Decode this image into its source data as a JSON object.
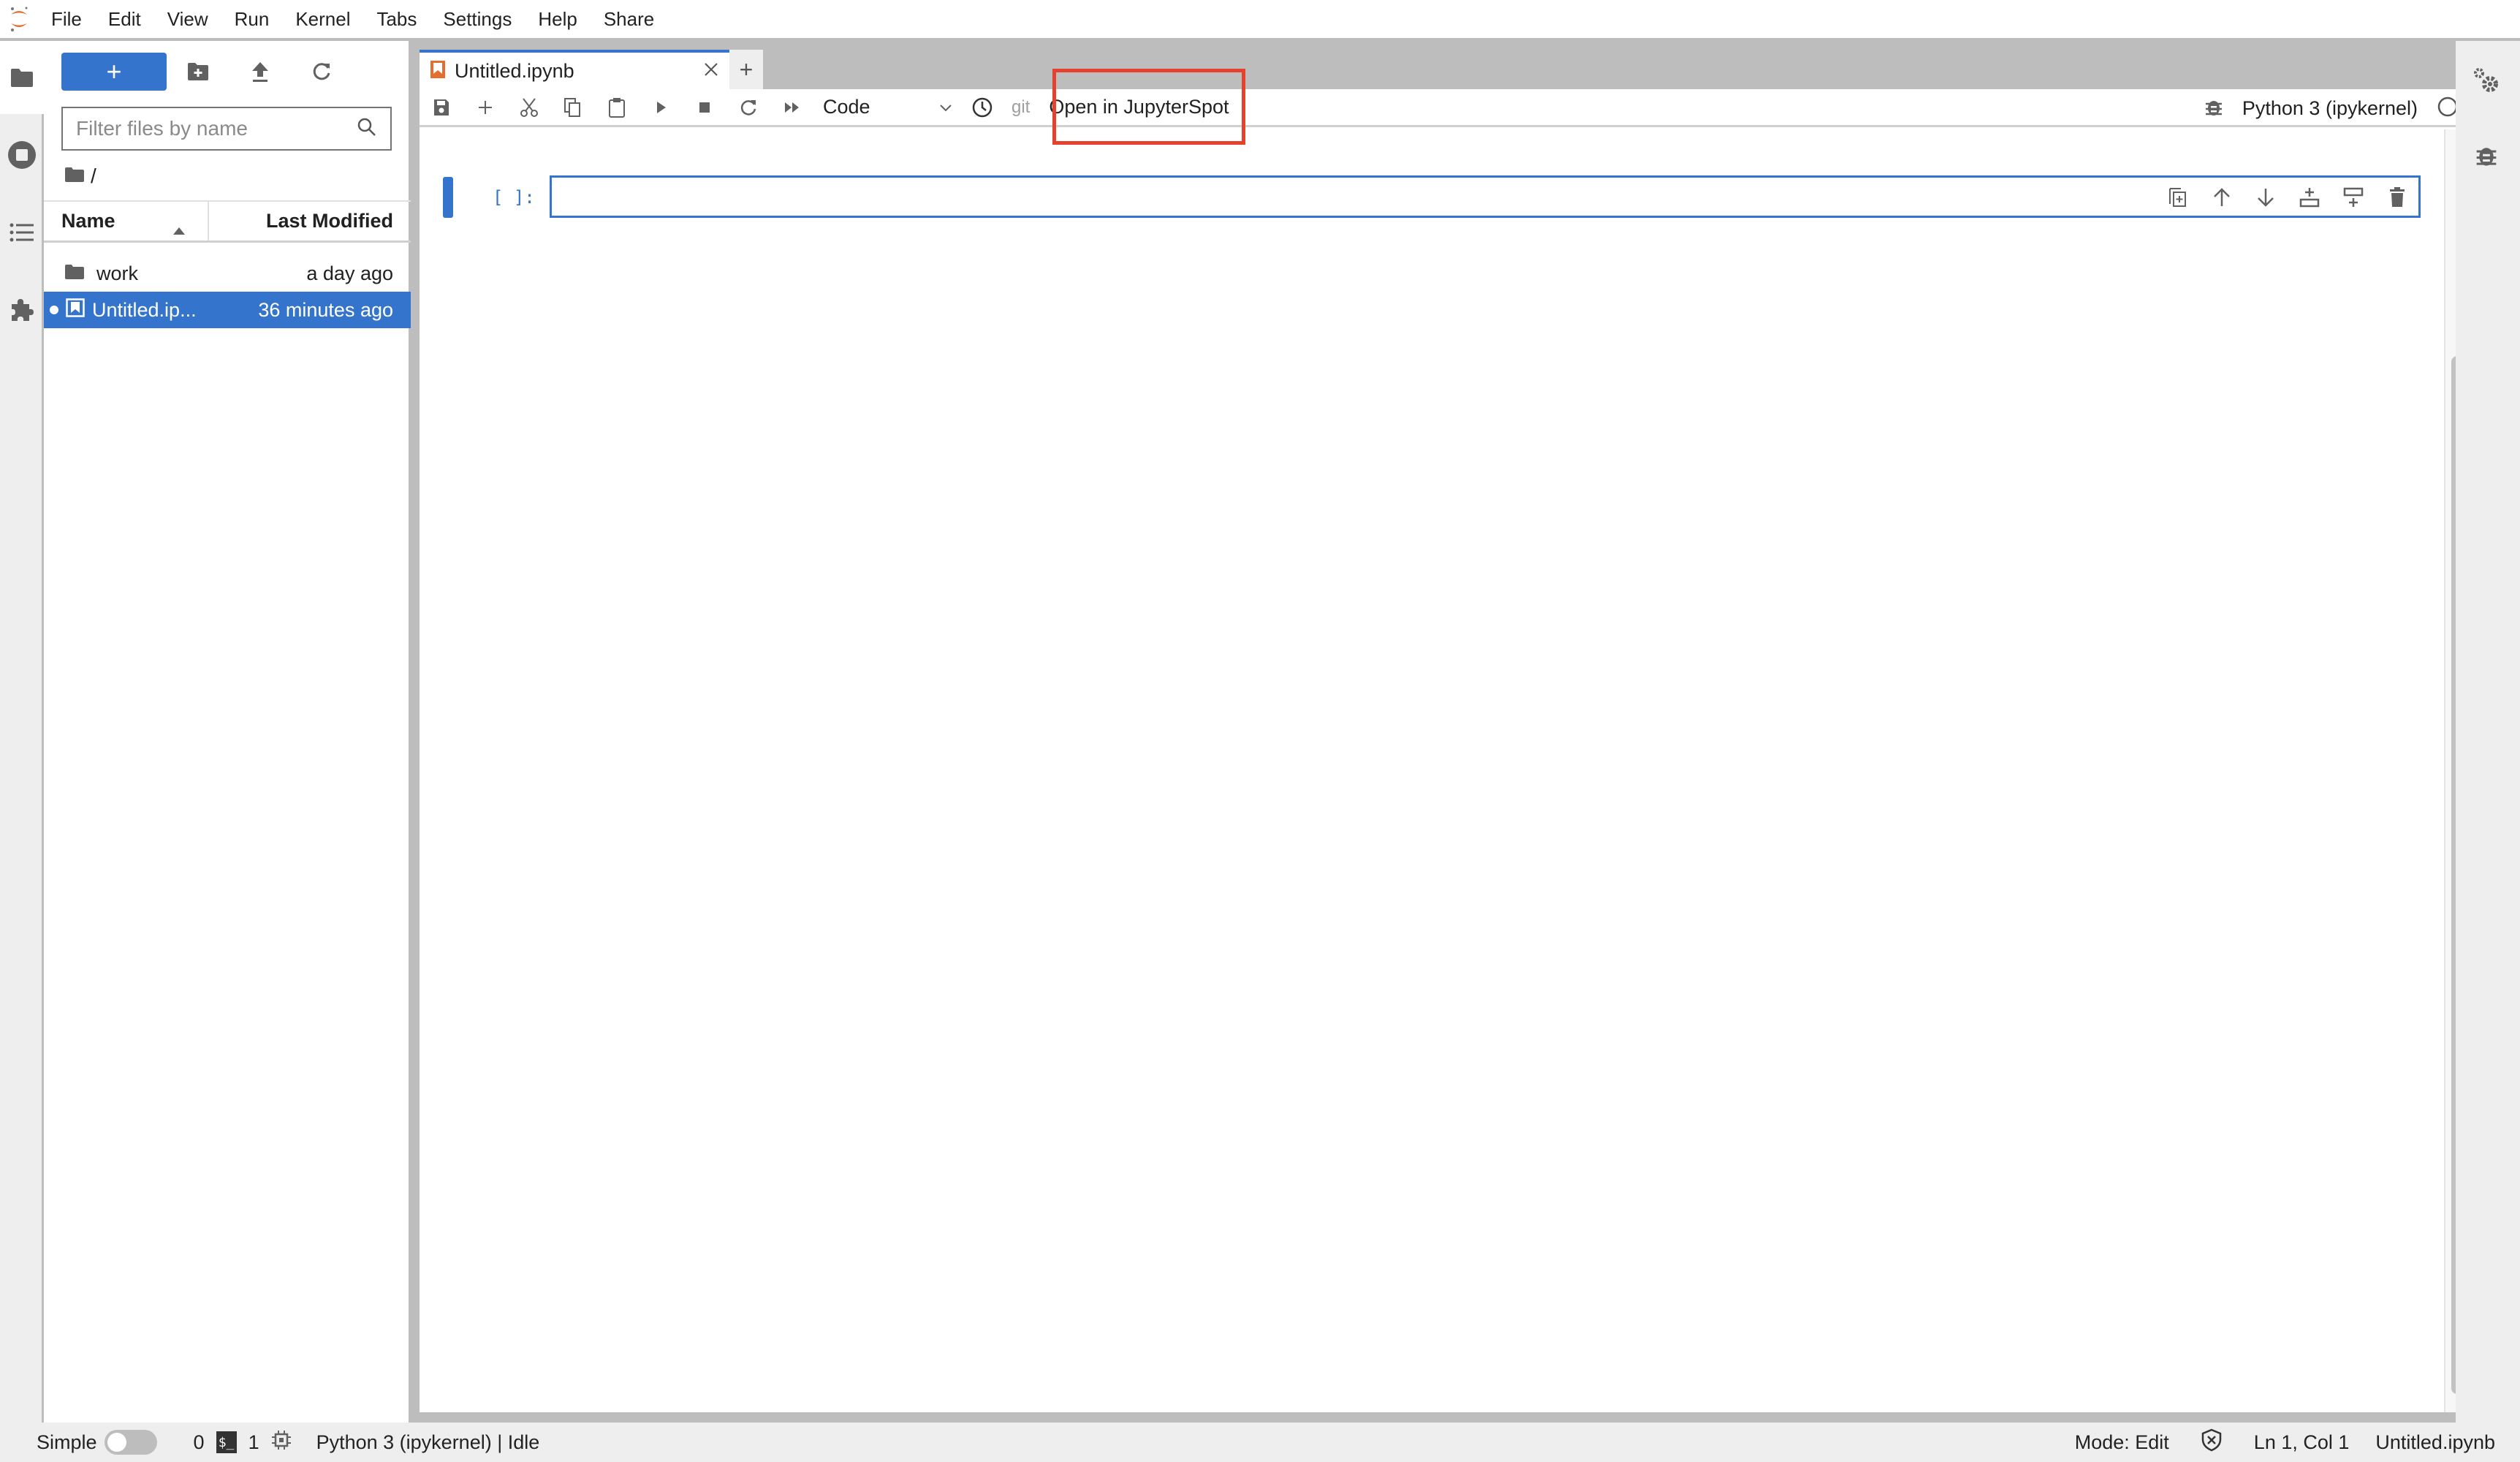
{
  "menubar": {
    "items": [
      "File",
      "Edit",
      "View",
      "Run",
      "Kernel",
      "Tabs",
      "Settings",
      "Help",
      "Share"
    ]
  },
  "left_strip": {
    "icons": [
      "folder-icon",
      "running-stop-icon",
      "table-of-contents-icon",
      "extension-puzzle-icon"
    ]
  },
  "filebrowser": {
    "new_button_label": "+",
    "filter_placeholder": "Filter files by name",
    "filter_value": "",
    "breadcrumb": "/",
    "columns": {
      "name": "Name",
      "modified": "Last Modified"
    },
    "files": [
      {
        "name": "work",
        "type": "folder",
        "modified": "a day ago",
        "selected": false
      },
      {
        "name": "Untitled.ip...",
        "type": "notebook",
        "modified": "36 minutes ago",
        "selected": true,
        "running": true
      }
    ]
  },
  "tabs": [
    {
      "title": "Untitled.ipynb",
      "active": true
    }
  ],
  "add_tab_label": "+",
  "toolbar": {
    "cell_type": "Code",
    "git_label": "git",
    "jupyterspot_label": "Open in JupyterSpot",
    "kernel_name": "Python 3 (ipykernel)",
    "highlight_color": "#e5412d"
  },
  "cell": {
    "prompt": "[ ]:",
    "source": ""
  },
  "statusbar": {
    "simple_label": "Simple",
    "simple_enabled": false,
    "terminals_count": "0",
    "terminal_icon_text": "$_",
    "kernels_count": "1",
    "kernel_status": "Python 3 (ipykernel) | Idle",
    "mode": "Mode: Edit",
    "cursor": "Ln 1, Col 1",
    "filename": "Untitled.ipynb"
  },
  "colors": {
    "accent": "#3574cc",
    "jupyter_orange": "#e46e2e"
  }
}
